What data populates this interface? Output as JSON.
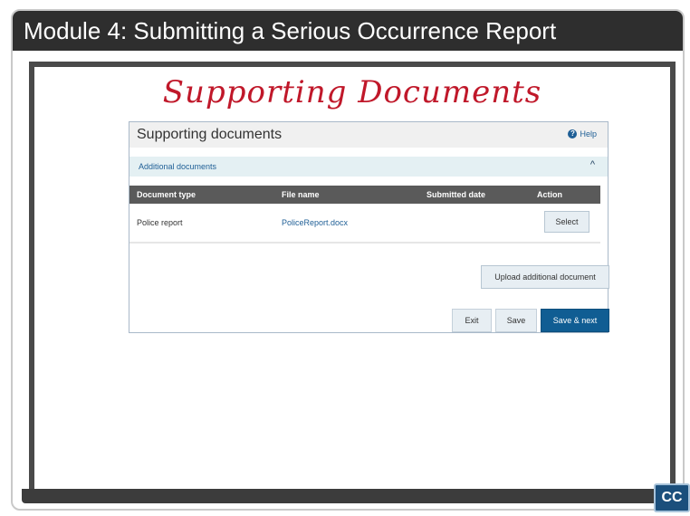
{
  "module_title": "Module 4:  Submitting a Serious Occurrence Report",
  "slide_heading": "Supporting Documents",
  "form": {
    "title": "Supporting documents",
    "help_label": "Help",
    "help_icon": "?",
    "accordion_label": "Additional documents",
    "accordion_chevron": "^",
    "columns": [
      "Document type",
      "File name",
      "Submitted date",
      "Action"
    ],
    "rows": [
      {
        "document_type": "Police report",
        "file_name": "PoliceReport.docx",
        "submitted_date": "",
        "action": "Select"
      }
    ],
    "upload_label": "Upload additional document",
    "exit_label": "Exit",
    "save_label": "Save",
    "save_next_label": "Save & next"
  },
  "cc_label": "CC",
  "colors": {
    "title_bar": "#2e2e2e",
    "heading": "#c0182a",
    "accent": "#105d93",
    "accordion": "#e4f0f3",
    "table_header": "#5a5a5a"
  }
}
